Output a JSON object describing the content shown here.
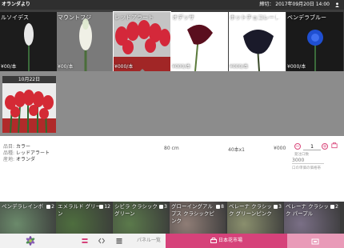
{
  "header": {
    "brand": "オランダより",
    "deadline_label": "締切：",
    "deadline": "2017年09月20日 14:00",
    "user_icon": "user-icon"
  },
  "top_cards": [
    {
      "name": "ルソイデス",
      "price": "¥00/本",
      "badge": "",
      "bg": "#1c1c1c",
      "flower": "white-spike"
    },
    {
      "name": "マウントフジ",
      "price": "¥00/本",
      "badge": "",
      "bg": "#6a6a6a",
      "flower": "white-cluster"
    },
    {
      "name": "レッドアラート",
      "price": "¥000/本",
      "badge": "",
      "bg": "#bdbdbd",
      "flower": "red-calla",
      "selected": true
    },
    {
      "name": "オデッサ",
      "price": "¥000/本",
      "badge": "2",
      "bg": "#ffffff",
      "flower": "dark-calla"
    },
    {
      "name": "ホットチョコレート",
      "price": "¥000/本",
      "badge": "2",
      "bg": "#ffffff",
      "flower": "black-calla"
    },
    {
      "name": "ベンデラブルー",
      "price": "¥000/本",
      "badge": "",
      "bg": "#1a1a1a",
      "flower": "blue-rose"
    }
  ],
  "selected_lot": {
    "date_label": "10月22日"
  },
  "detail": {
    "item_key": "品目:",
    "item_val": "カラー",
    "variety_key": "品種:",
    "variety_val": "レッドアラート",
    "origin_key": "産地:",
    "origin_val": "オランダ",
    "length": "80 cm",
    "pack": "40本x1",
    "price": "¥000",
    "qty": "1",
    "qty_sub": "発注口数",
    "unit_price_placeholder": "3000",
    "unit_sub": "口の単価の価格帯"
  },
  "bottom_cards": [
    {
      "name": "ペンデラレインボ",
      "badge": "2",
      "bg": "#6b8a6b"
    },
    {
      "name": "エメラルド グリーン",
      "badge": "12",
      "bg": "#4e6e3e"
    },
    {
      "name": "シビラ クラシック グリーン",
      "badge": "3",
      "bg": "#5b7a4b"
    },
    {
      "name": "グローイングアルプス クラシックピンク",
      "badge": "8",
      "bg": "#8f7d76"
    },
    {
      "name": "ベレーナ クラシック グリーンピンク",
      "badge": "3",
      "bg": "#8a8f6d"
    },
    {
      "name": "ベレーナ クラシック パープル",
      "badge": "2",
      "bg": "#7a6f86"
    }
  ],
  "nav": {
    "panel_label": "パネル一覧",
    "market_label": "日本花市場",
    "colors": {
      "accent": "#d6427a",
      "accent_light": "#e99ab8"
    }
  }
}
